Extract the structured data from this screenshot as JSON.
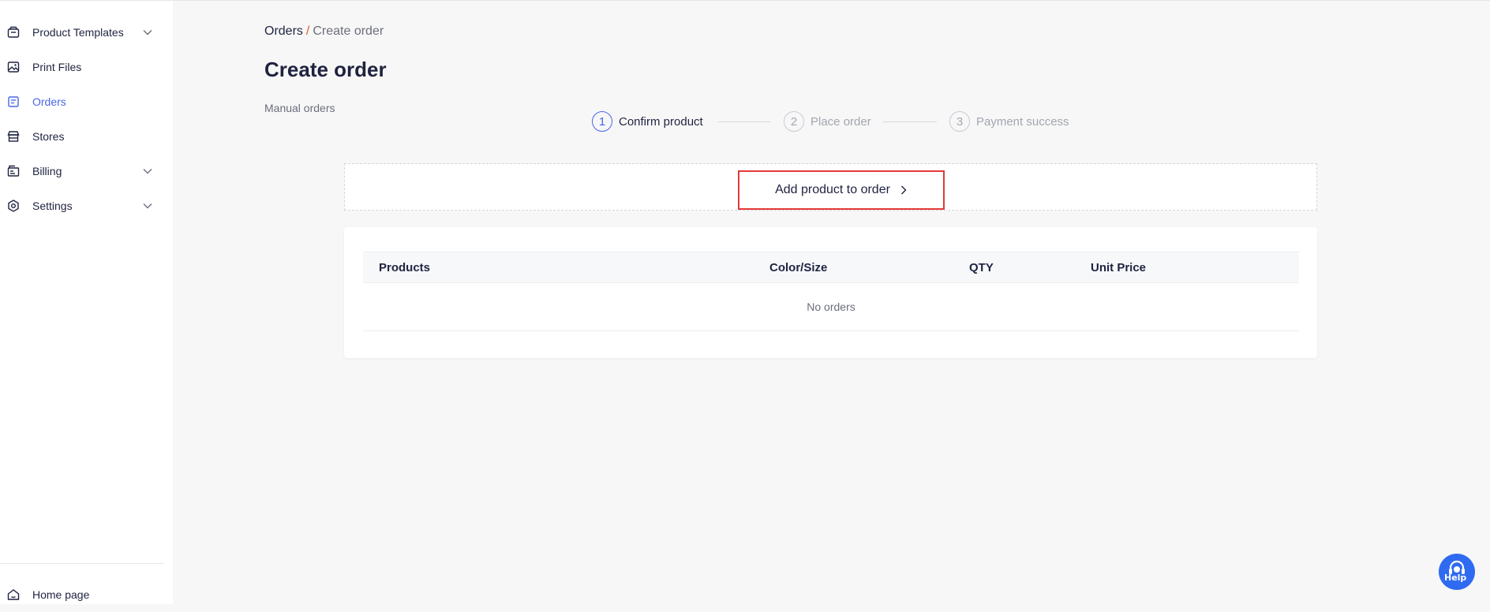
{
  "sidebar": {
    "items": [
      {
        "label": "Product Templates",
        "icon": "box-icon",
        "has_chevron": true,
        "active": false
      },
      {
        "label": "Print Files",
        "icon": "image-icon",
        "has_chevron": false,
        "active": false
      },
      {
        "label": "Orders",
        "icon": "orders-icon",
        "has_chevron": false,
        "active": true
      },
      {
        "label": "Stores",
        "icon": "store-icon",
        "has_chevron": false,
        "active": false
      },
      {
        "label": "Billing",
        "icon": "billing-icon",
        "has_chevron": true,
        "active": false
      },
      {
        "label": "Settings",
        "icon": "settings-icon",
        "has_chevron": true,
        "active": false
      }
    ],
    "footer": {
      "label": "Home page",
      "icon": "home-icon"
    }
  },
  "breadcrumb": {
    "parent": "Orders",
    "separator": "/",
    "current": "Create order"
  },
  "page": {
    "title": "Create order",
    "subtitle": "Manual orders"
  },
  "steps": [
    {
      "number": "1",
      "label": "Confirm product",
      "active": true
    },
    {
      "number": "2",
      "label": "Place order",
      "active": false
    },
    {
      "number": "3",
      "label": "Payment success",
      "active": false
    }
  ],
  "add_product": {
    "label": "Add product to order"
  },
  "table": {
    "columns": [
      "Products",
      "Color/Size",
      "QTY",
      "Unit Price"
    ],
    "empty_text": "No orders"
  },
  "help": {
    "label": "Help"
  },
  "colors": {
    "accent": "#4a66e8",
    "highlight_border": "#e53935",
    "help_button": "#2f6bf0",
    "breadcrumb_separator": "#e05a2a"
  }
}
